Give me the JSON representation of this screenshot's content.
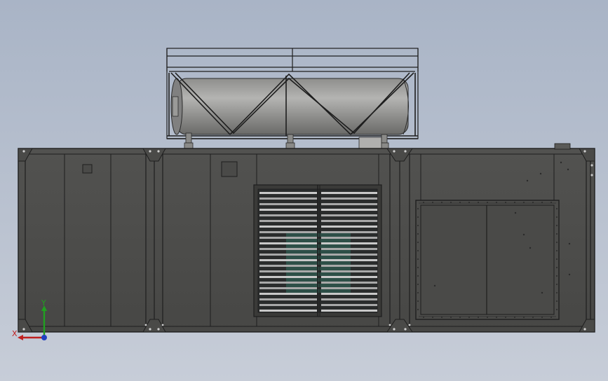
{
  "viewport": {
    "background_top": "#a9b4c6",
    "background_bottom": "#c7cdd8"
  },
  "model": {
    "description_kind": "generator set enclosure with roof-mounted exhaust silencer",
    "body_color": "#4a4a48",
    "edge_color": "#1e1e1e",
    "tank_color": "#9a9a98",
    "engine_accent": "#2f6d5f"
  },
  "triad": {
    "x_label": "X",
    "y_label": "Y",
    "x_color": "#c02020",
    "y_color": "#20a020",
    "z_color": "#2040c0"
  }
}
